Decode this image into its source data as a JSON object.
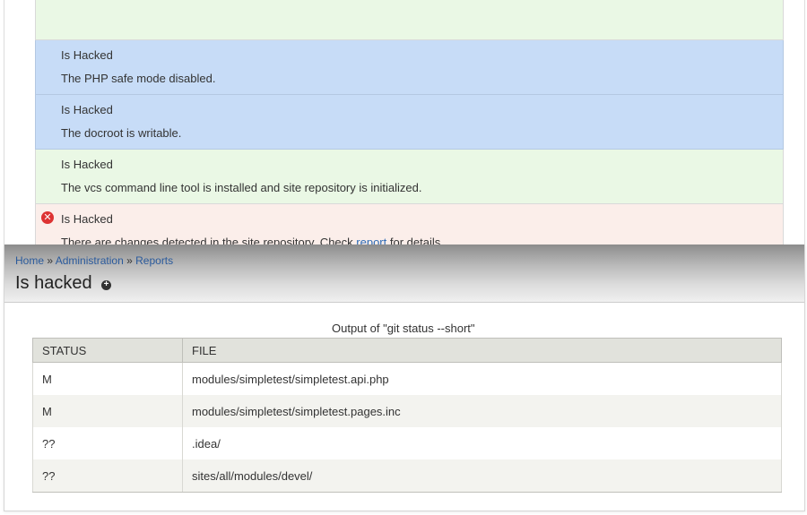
{
  "status_report": {
    "rows": [
      {
        "title": "",
        "desc": "",
        "color": "green",
        "stub": true
      },
      {
        "title": "Is Hacked",
        "desc": "The PHP safe mode disabled.",
        "color": "blue"
      },
      {
        "title": "Is Hacked",
        "desc": "The docroot is writable.",
        "color": "blue"
      },
      {
        "title": "Is Hacked",
        "desc": "The vcs command line tool is installed and site repository is initialized.",
        "color": "green"
      },
      {
        "title": "Is Hacked",
        "desc_before": "There are changes detected in the site repository. Check ",
        "link": "report",
        "desc_after": " for details.",
        "color": "red",
        "icon": "error-icon"
      },
      {
        "title": "",
        "desc": "",
        "color": "green",
        "stub": true
      }
    ]
  },
  "breadcrumb": {
    "home": "Home",
    "sep1": "»",
    "administration": "Administration",
    "sep2": "»",
    "reports": "Reports"
  },
  "page": {
    "title": "Is hacked",
    "shortcut_icon": "plus-circle-icon"
  },
  "git_table": {
    "caption": "Output of \"git status --short\"",
    "headers": [
      "STATUS",
      "FILE"
    ],
    "rows": [
      {
        "status": "M",
        "file": "modules/simpletest/simpletest.api.php"
      },
      {
        "status": "M",
        "file": "modules/simpletest/simpletest.pages.inc"
      },
      {
        "status": "??",
        "file": ".idea/"
      },
      {
        "status": "??",
        "file": "sites/all/modules/devel/"
      }
    ]
  },
  "colors": {
    "green": "#eaf8e5",
    "blue": "#c7dcf7",
    "red": "#fbeeea",
    "link": "#2e6bb5"
  }
}
